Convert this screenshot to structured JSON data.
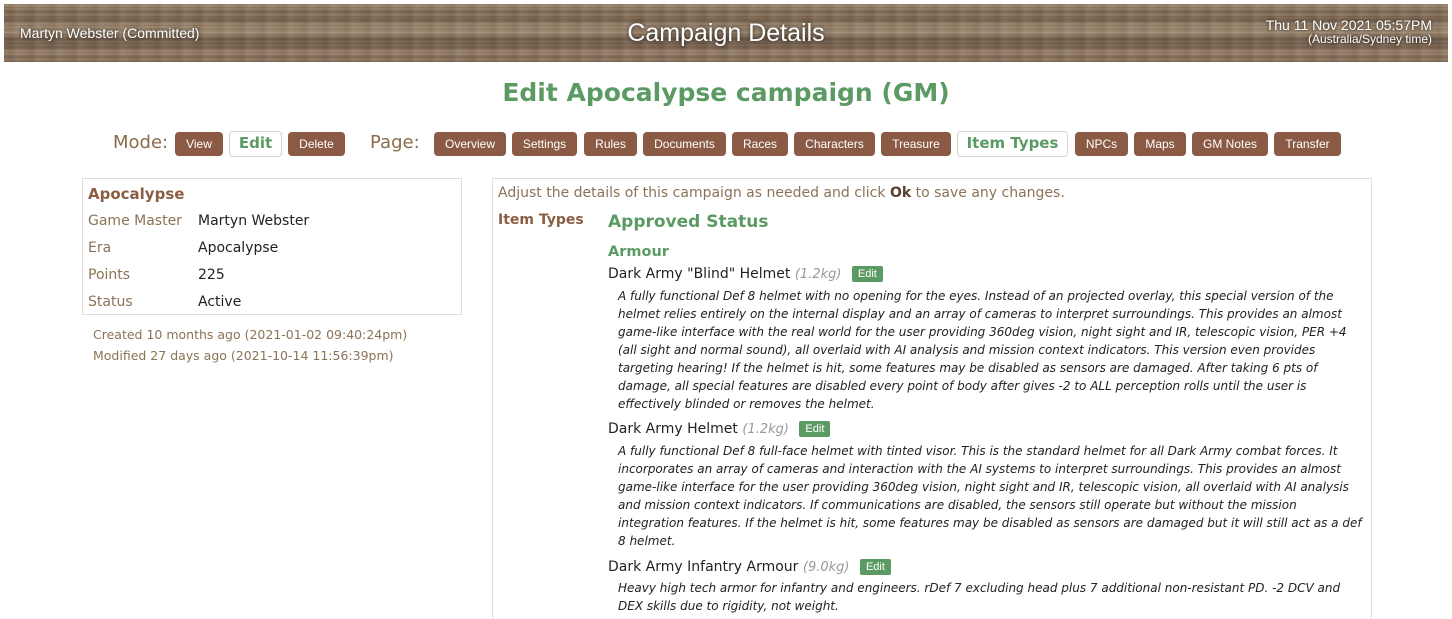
{
  "header": {
    "user": "Martyn Webster (Committed)",
    "title": "Campaign Details",
    "datetime": "Thu 11 Nov 2021 05:57PM",
    "timezone": "(Australia/Sydney time)"
  },
  "heading": "Edit Apocalypse campaign (GM)",
  "mode": {
    "label": "Mode:",
    "buttons": [
      "View",
      "Edit",
      "Delete"
    ],
    "active": "Edit"
  },
  "page": {
    "label": "Page:",
    "buttons": [
      "Overview",
      "Settings",
      "Rules",
      "Documents",
      "Races",
      "Characters",
      "Treasure",
      "Item Types",
      "NPCs",
      "Maps",
      "GM Notes",
      "Transfer"
    ],
    "active": "Item Types"
  },
  "campaign": {
    "name": "Apocalypse",
    "fields": [
      {
        "key": "Game Master",
        "value": "Martyn Webster"
      },
      {
        "key": "Era",
        "value": "Apocalypse"
      },
      {
        "key": "Points",
        "value": "225"
      },
      {
        "key": "Status",
        "value": "Active"
      }
    ],
    "created": "Created 10 months ago (2021-01-02 09:40:24pm)",
    "modified": "Modified 27 days ago (2021-10-14 11:56:39pm)"
  },
  "main": {
    "intro_prefix": "Adjust the details of this campaign as needed and click",
    "intro_bold": "Ok",
    "intro_suffix": "to save any changes.",
    "section_label": "Item Types",
    "status_heading": "Approved Status",
    "category": "Armour",
    "edit_label": "Edit",
    "items": [
      {
        "name": "Dark Army \"Blind\" Helmet",
        "weight": "(1.2kg)",
        "description": "A fully functional Def 8 helmet with no opening for the eyes. Instead of an projected overlay, this special version of the helmet relies entirely on the internal display and an array of cameras to interpret surroundings. This provides an almost game-like interface with the real world for the user providing 360deg vision, night sight and IR, telescopic vision, PER +4 (all sight and normal sound), all overlaid with AI analysis and mission context indicators. This version even provides targeting hearing! If the helmet is hit, some features may be disabled as sensors are damaged. After taking 6 pts of damage, all special features are disabled every point of body after gives -2 to ALL perception rolls until the user is effectively blinded or removes the helmet."
      },
      {
        "name": "Dark Army Helmet",
        "weight": "(1.2kg)",
        "description": "A fully functional Def 8 full-face helmet with tinted visor. This is the standard helmet for all Dark Army combat forces. It incorporates an array of cameras and interaction with the AI systems to interpret surroundings. This provides an almost game-like interface for the user providing 360deg vision, night sight and IR, telescopic vision, all overlaid with AI analysis and mission context indicators. If communications are disabled, the sensors still operate but without the mission integration features. If the helmet is hit, some features may be disabled as sensors are damaged but it will still act as a def 8 helmet."
      },
      {
        "name": "Dark Army Infantry Armour",
        "weight": "(9.0kg)",
        "description": "Heavy high tech armor for infantry and engineers. rDef 7 excluding head plus 7 additional non-resistant PD. -2 DCV and DEX skills due to rigidity, not weight."
      }
    ]
  }
}
